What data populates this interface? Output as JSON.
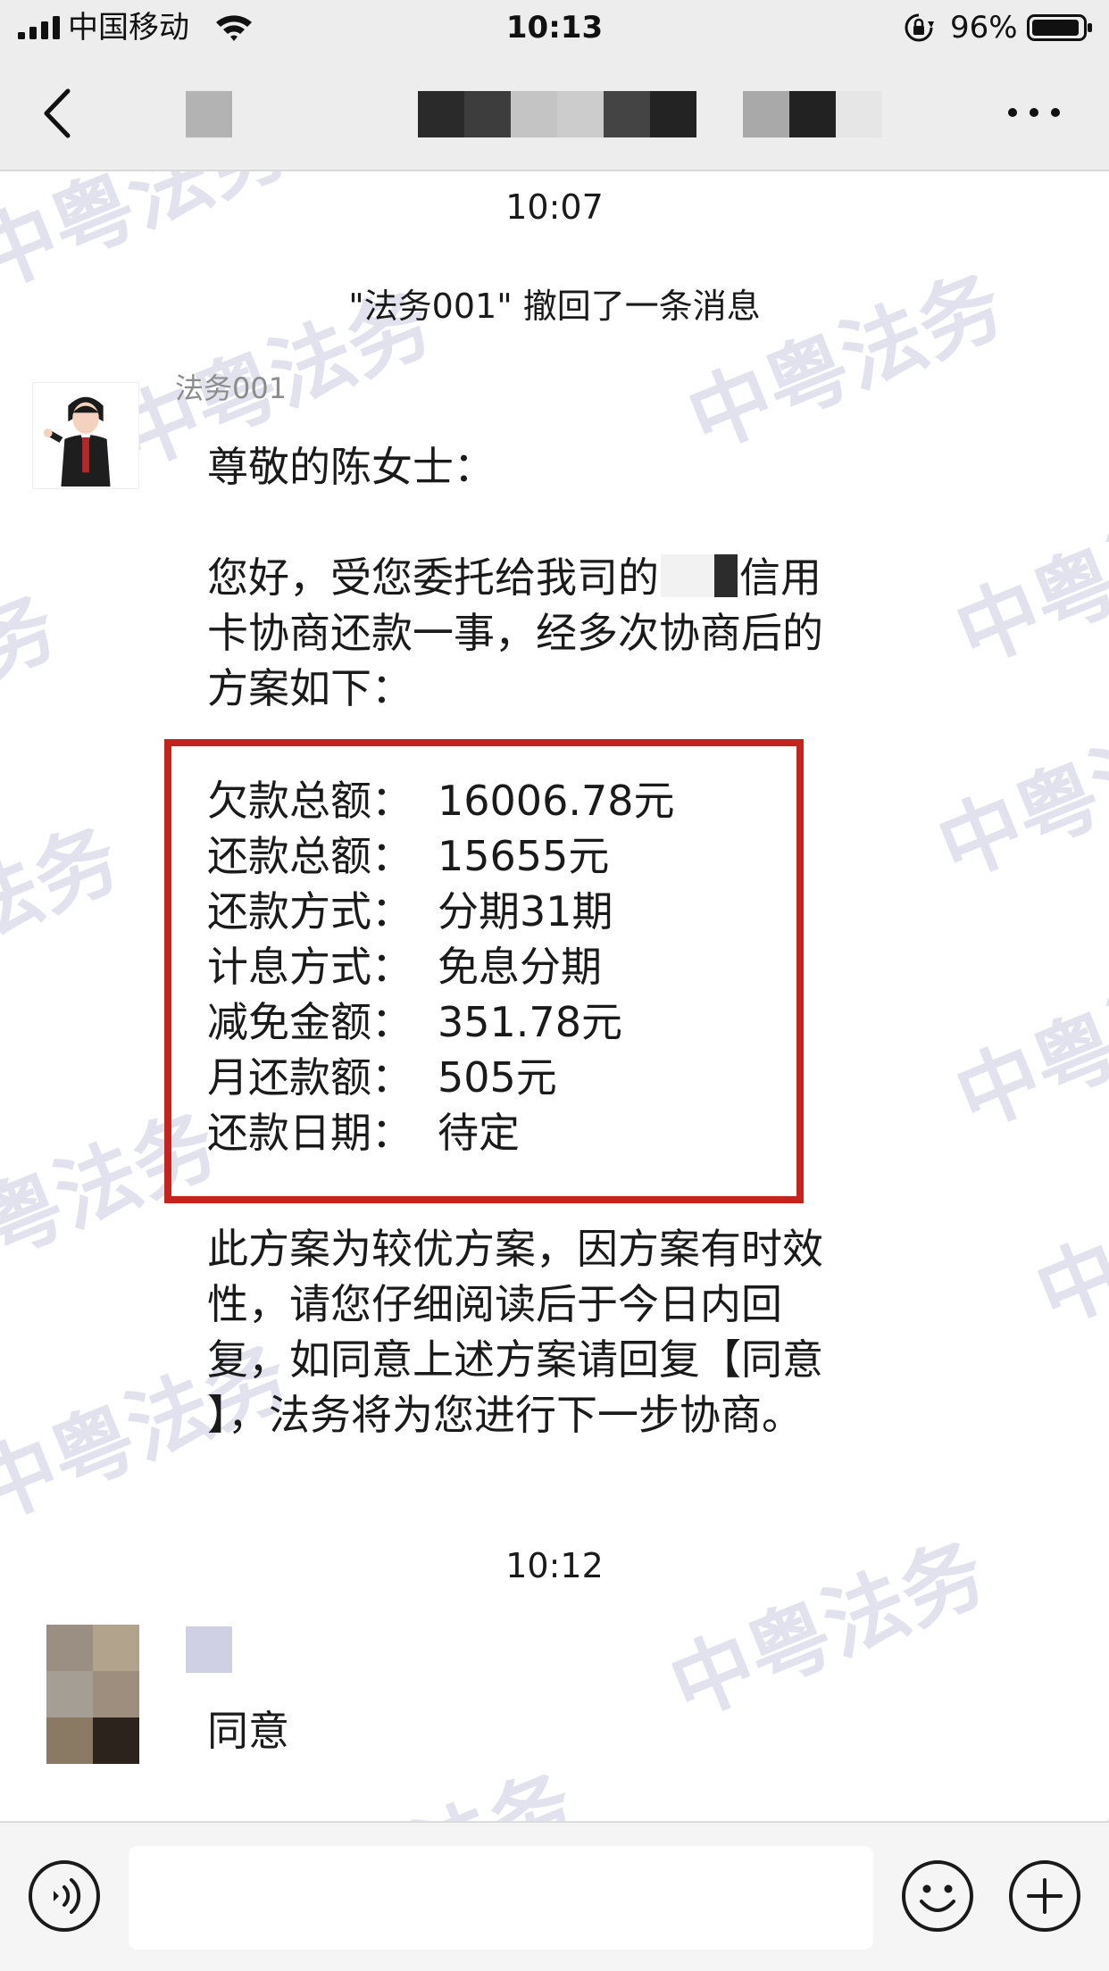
{
  "status_bar": {
    "carrier": "中国移动",
    "time": "10:13",
    "battery_percent": "96%"
  },
  "nav": {
    "icons": [
      "back-chevron-icon",
      "more-dots-icon"
    ]
  },
  "chat": {
    "watermark_text": "中粤法务",
    "time_first": "10:07",
    "recall_notice": "\"法务001\" 撤回了一条消息",
    "lawyer": {
      "name": "法务001",
      "greeting": "尊敬的陈女士：",
      "intro_lines": [
        "您好，受您委托给我司的",
        "信用",
        "卡协商还款一事，经多次协商后的",
        "方案如下："
      ],
      "plan": [
        {
          "label": "欠款总额：",
          "value": "16006.78元"
        },
        {
          "label": "还款总额：",
          "value": "15655元"
        },
        {
          "label": "还款方式：",
          "value": "分期31期"
        },
        {
          "label": "计息方式：",
          "value": "免息分期"
        },
        {
          "label": "减免金额：",
          "value": "351.78元"
        },
        {
          "label": "月还款额：",
          "value": "505元"
        },
        {
          "label": "还款日期：",
          "value": "待定"
        }
      ],
      "closing_lines": [
        "此方案为较优方案，因方案有时效",
        "性，请您仔细阅读后于今日内回",
        "复，如同意上述方案请回复【同意",
        "】，法务将为您进行下一步协商。"
      ]
    },
    "time_second": "10:12",
    "user": {
      "message": "同意"
    }
  },
  "input_bar": {
    "icons": [
      "voice-icon",
      "emoji-icon",
      "plus-icon"
    ]
  },
  "colors": {
    "bar_bg": "#ededed",
    "highlight_border": "#c4241d",
    "watermark": "#c9cbdf"
  }
}
